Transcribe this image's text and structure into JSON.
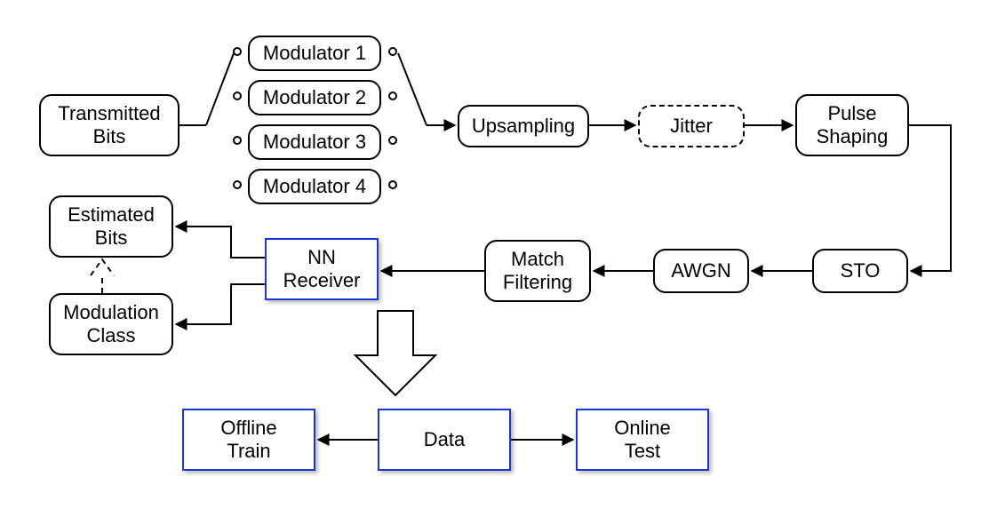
{
  "blocks": {
    "tx_bits": "Transmitted\nBits",
    "mod1": "Modulator 1",
    "mod2": "Modulator 2",
    "mod3": "Modulator 3",
    "mod4": "Modulator 4",
    "upsampling": "Upsampling",
    "jitter": "Jitter",
    "pulse_shaping": "Pulse\nShaping",
    "sto": "STO",
    "awgn": "AWGN",
    "match_filtering": "Match\nFiltering",
    "nn_receiver": "NN\nReceiver",
    "est_bits": "Estimated\nBits",
    "mod_class": "Modulation\nClass",
    "offline_train": "Offline\nTrain",
    "data": "Data",
    "online_test": "Online\nTest"
  },
  "edges": [
    {
      "from": "tx_bits",
      "to": "mod_switch_left"
    },
    {
      "from": "mod_switch_right",
      "to": "upsampling"
    },
    {
      "from": "upsampling",
      "to": "jitter"
    },
    {
      "from": "jitter",
      "to": "pulse_shaping"
    },
    {
      "from": "pulse_shaping",
      "to": "sto"
    },
    {
      "from": "sto",
      "to": "awgn"
    },
    {
      "from": "awgn",
      "to": "match_filtering"
    },
    {
      "from": "match_filtering",
      "to": "nn_receiver"
    },
    {
      "from": "nn_receiver",
      "to": "est_bits"
    },
    {
      "from": "nn_receiver",
      "to": "mod_class"
    },
    {
      "from": "mod_class",
      "to": "est_bits",
      "style": "dashed"
    },
    {
      "from": "nn_receiver",
      "to": "data",
      "style": "hollow"
    },
    {
      "from": "data",
      "to": "offline_train"
    },
    {
      "from": "data",
      "to": "online_test"
    }
  ],
  "diagram_type": "block-flow",
  "colors": {
    "highlight": "#1a36d6",
    "normal": "#000000"
  }
}
